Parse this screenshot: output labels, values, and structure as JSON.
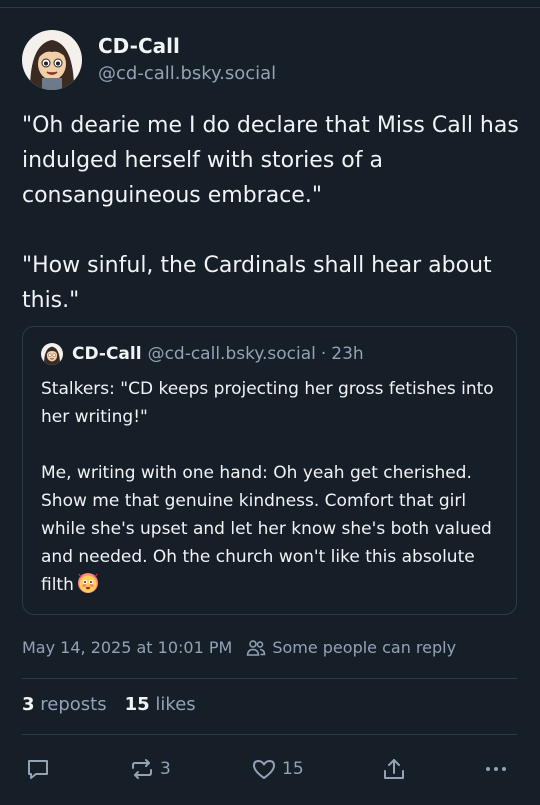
{
  "author": {
    "display_name": "CD-Call",
    "handle": "@cd-call.bsky.social",
    "avatar_icon": "avatar-icon"
  },
  "post": {
    "paragraphs": [
      "\"Oh dearie me I do declare that Miss Call has indulged herself with stories of a consanguineous embrace.\"",
      "\"How sinful, the Cardinals shall hear about this.\""
    ]
  },
  "quote": {
    "display_name": "CD-Call",
    "handle": "@cd-call.bsky.social",
    "separator": "·",
    "time": "23h",
    "paragraphs": [
      "Stalkers: \"CD keeps projecting her gross fetishes into her writing!\"",
      "Me, writing with one hand: Oh yeah get cherished. Show me that genuine kindness. Comfort that girl while she's upset and let her know she's both valued and needed. Oh the church won't like this absolute filth"
    ],
    "emoji_icon": "flushed-face-emoji-icon"
  },
  "meta": {
    "timestamp": "May 14, 2025 at 10:01 PM",
    "reply_setting": "Some people can reply"
  },
  "stats": {
    "reposts_count": "3",
    "reposts_label": "reposts",
    "likes_count": "15",
    "likes_label": "likes"
  },
  "actions": {
    "reply_count": "",
    "repost_count": "3",
    "like_count": "15"
  },
  "colors": {
    "background": "#161e27",
    "text": "#f1f3f5",
    "muted": "#93a2b7",
    "border": "#2e3a48"
  }
}
